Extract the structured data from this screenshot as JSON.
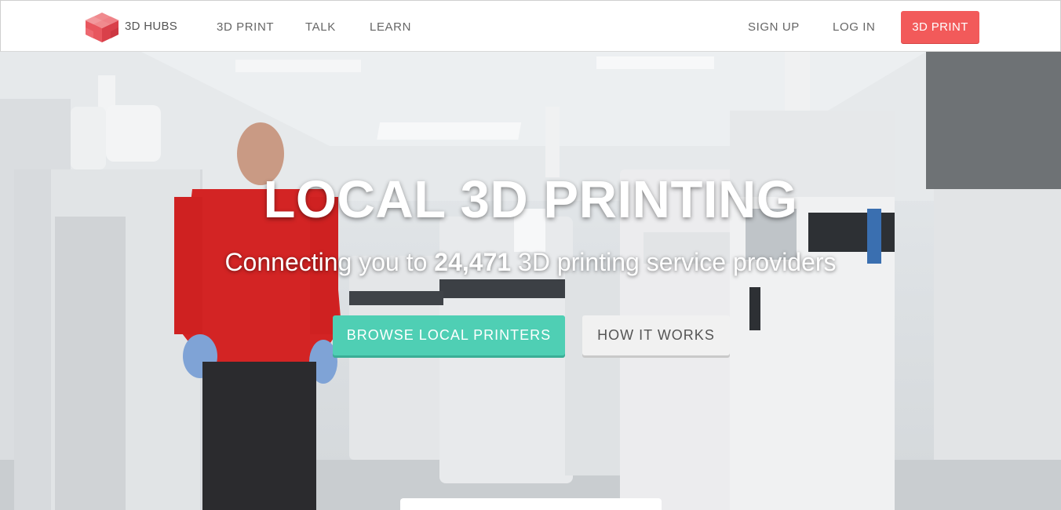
{
  "nav": {
    "brand": "3D HUBS",
    "links": {
      "print": "3D PRINT",
      "talk": "TALK",
      "learn": "LEARN",
      "signup": "SIGN UP",
      "login": "LOG IN"
    },
    "cta": "3D PRINT"
  },
  "hero": {
    "title": "LOCAL 3D PRINTING",
    "subtitle_prefix": "Connecting you to ",
    "subtitle_count": "24,471",
    "subtitle_suffix": " 3D printing service providers",
    "browse_button": "BROWSE LOCAL PRINTERS",
    "how_button": "HOW IT WORKS"
  },
  "colors": {
    "cta": "#f25a5a",
    "browse": "#4fcfb4",
    "logo": "#e8565e"
  },
  "icons": [
    "3d-hubs-cube-logo-icon"
  ]
}
